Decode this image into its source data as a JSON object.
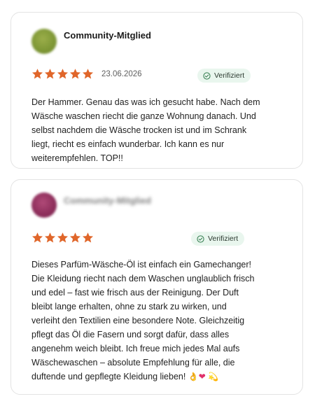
{
  "reviews": [
    {
      "author": "Community-Mitglied",
      "rating": 5,
      "date": "23.06.2026",
      "badge": "Verifiziert",
      "text": "Der Hammer. Genau das was ich gesucht habe. Nach dem Wäsche waschen riecht die ganze Wohnung danach. Und selbst nachdem die Wäsche trocken ist und im Schrank liegt, riecht es einfach wunderbar. Ich kann es nur weiterempfehlen. TOP!!"
    },
    {
      "author": "Community-Mitglied",
      "rating": 5,
      "badge": "Verifiziert",
      "text": "Dieses Parfüm-Wäsche-Öl ist einfach ein Gamechanger! Die Kleidung riecht nach dem Waschen unglaublich frisch und edel – fast wie frisch aus der Reinigung. Der Duft bleibt lange erhalten, ohne zu stark zu wirken, und verleiht den Textilien eine besondere Note. Gleichzeitig pflegt das Öl die Fasern und sorgt dafür, dass alles angenehm weich bleibt. Ich freue mich jedes Mal aufs Wäschewaschen – absolute Empfehlung für alle, die duftende und gepflegte Kleidung lieben!",
      "emojis": [
        "👌",
        "❤",
        "💫"
      ]
    }
  ],
  "colors": {
    "star": "#e0662a",
    "badge_bg": "#e9f6ee",
    "badge_icon": "#2f7a4b"
  },
  "icons": {
    "star": "star-icon",
    "verified": "check-circle-icon"
  }
}
